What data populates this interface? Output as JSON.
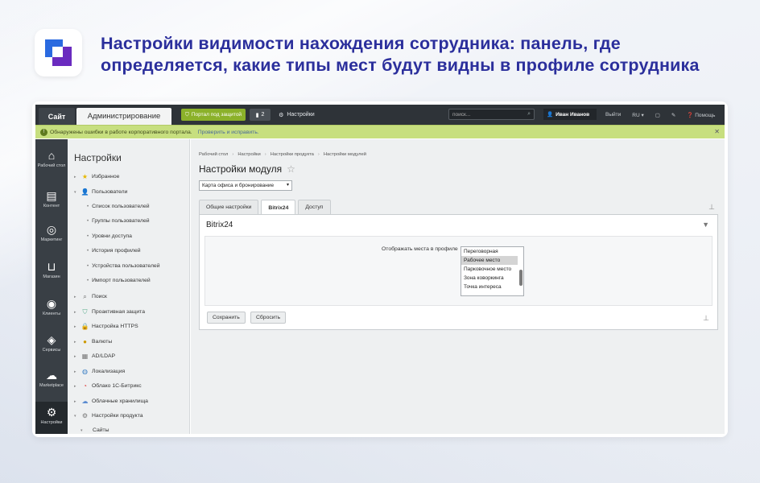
{
  "headline": "Настройки видимости нахождения сотрудника: панель, где определяется, какие типы мест будут видны в профиле сотрудника",
  "topbar": {
    "tab_site": "Сайт",
    "tab_admin": "Администрирование",
    "portal_button": "Портал под защитой",
    "notifications_count": "2",
    "settings_label": "Настройки",
    "search_placeholder": "поиск...",
    "user_name": "Иван Иванов",
    "logout": "Выйти",
    "lang": "RU",
    "help": "Помощь"
  },
  "notice": {
    "text": "Обнаружены ошибки в работе корпоративного портала.",
    "link": "Проверить и исправить."
  },
  "iconbar": [
    {
      "label": "Рабочий стол",
      "icon": "home-icon"
    },
    {
      "label": "Контент",
      "icon": "document-icon"
    },
    {
      "label": "Маркетинг",
      "icon": "target-icon"
    },
    {
      "label": "Магазин",
      "icon": "basket-icon"
    },
    {
      "label": "Клиенты",
      "icon": "clients-icon"
    },
    {
      "label": "Сервисы",
      "icon": "layers-icon"
    },
    {
      "label": "Marketplace",
      "icon": "cloud-download-icon"
    },
    {
      "label": "Настройки",
      "icon": "gear-icon"
    }
  ],
  "menu": {
    "title": "Настройки",
    "items": [
      "Избранное",
      "Пользователи",
      "Список пользователей",
      "Группы пользователей",
      "Уровни доступа",
      "История профилей",
      "Устройства пользователей",
      "Импорт пользователей",
      "Поиск",
      "Проактивная защита",
      "Настройка HTTPS",
      "Валюты",
      "AD/LDAP",
      "Локализация",
      "Облако 1С-Битрикс",
      "Облачные хранилища",
      "Настройки продукта",
      "Сайты"
    ]
  },
  "breadcrumbs": [
    "Рабочий стол",
    "Настройки",
    "Настройки продукта",
    "Настройки модулей"
  ],
  "page_title": "Настройки модуля",
  "module_select": "Карта офиса и бронирование",
  "tabs": [
    "Общие настройки",
    "Bitrix24",
    "Доступ"
  ],
  "panel": {
    "title": "Bitrix24",
    "field_label": "Отображать места в профиле",
    "options": [
      "Переговорная",
      "Рабочее место",
      "Парковочное место",
      "Зона коворкинга",
      "Точка интереса"
    ],
    "selected": "Рабочее место"
  },
  "buttons": {
    "save": "Сохранить",
    "reset": "Сбросить"
  },
  "colors": {
    "headline": "#2b2f9c",
    "topbar": "#2e3338",
    "notice": "#c7df7f",
    "portal_button": "#8bb12a"
  }
}
